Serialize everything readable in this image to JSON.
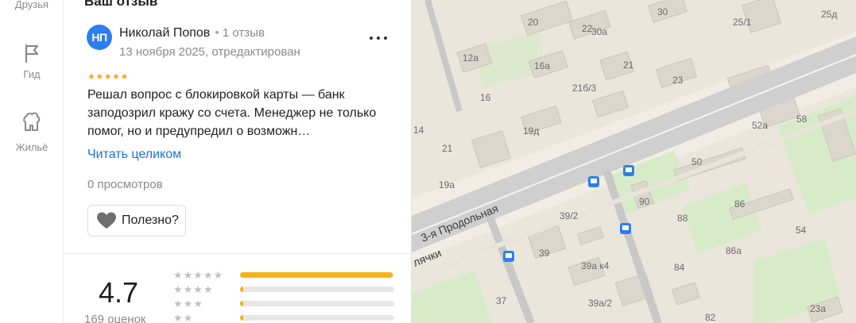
{
  "sidebar": {
    "items": [
      {
        "label": "Друзья",
        "icon": "friends-icon"
      },
      {
        "label": "Гид",
        "icon": "flag-icon"
      },
      {
        "label": "Жильё",
        "icon": "housing-icon"
      }
    ]
  },
  "review": {
    "heading": "Ваш отзыв",
    "avatar_initials": "НП",
    "author": "Николай Попов",
    "author_reviews": "1 отзыв",
    "date": "13 ноября 2025, отредактирован",
    "stars": "★★★★★",
    "text": "Решал вопрос с блокировкой карты — банк заподозрил кражу со счета. Менеджер не только помог, но и предупредил о возможн…",
    "read_more": "Читать целиком",
    "views": "0 просмотров",
    "helpful": "Полезно?"
  },
  "rating": {
    "value": "4.7",
    "count": "169 оценок",
    "distribution": [
      {
        "stars": "★★★★★",
        "fraction": 0.99
      },
      {
        "stars": "★★★★",
        "fraction": 0.02
      },
      {
        "stars": "★★★",
        "fraction": 0.02
      },
      {
        "stars": "★★",
        "fraction": 0.02
      }
    ]
  },
  "map": {
    "streets": [
      "3-я Продольная",
      "лячки"
    ],
    "building_numbers": [
      "20",
      "22",
      "30",
      "25/1",
      "25д",
      "12а",
      "30а",
      "16а",
      "21",
      "23",
      "21б/3",
      "16",
      "19д",
      "14",
      "52а",
      "58",
      "21",
      "50",
      "19а",
      "90",
      "86",
      "88",
      "39/2",
      "54",
      "39",
      "86а",
      "39а к4",
      "84",
      "37",
      "39а/2",
      "82",
      "23а"
    ],
    "colors": {
      "road": "#cfcfcf",
      "road_edge": "#b9b9b9",
      "block": "#e6e1d6",
      "building": "#d9d4ca",
      "park": "#d7ebc9",
      "transit": "#2b7ff0"
    }
  }
}
